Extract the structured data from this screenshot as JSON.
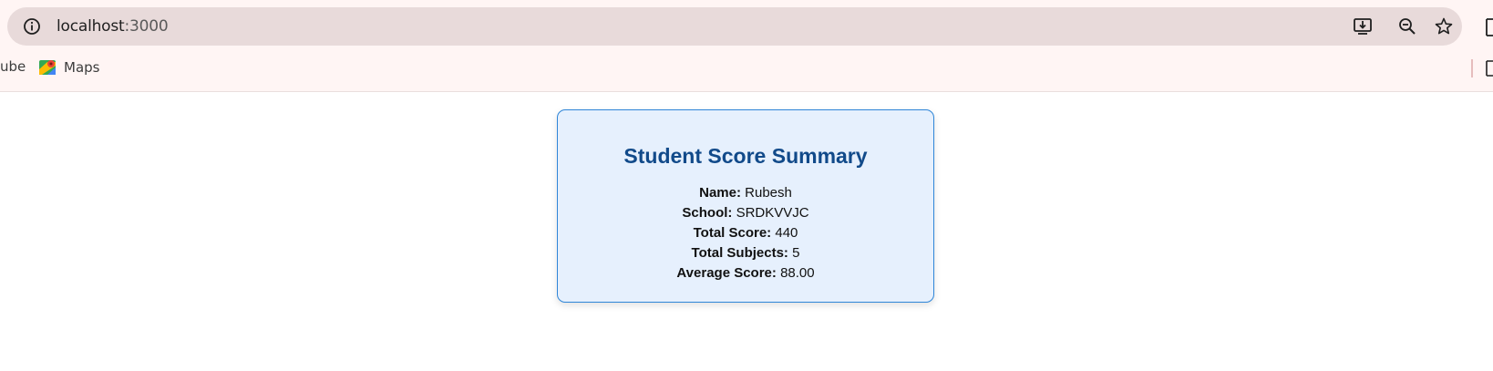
{
  "browser": {
    "url_host": "localhost",
    "url_port": ":3000",
    "icons": {
      "info": "info-icon",
      "install": "install-app-icon",
      "zoom": "zoom-out-icon",
      "bookmark": "star-icon"
    },
    "bookmarks": {
      "partial_label": "ube",
      "maps_label": "Maps"
    }
  },
  "summary": {
    "title": "Student Score Summary",
    "fields": [
      {
        "label": "Name:",
        "value": "Rubesh"
      },
      {
        "label": "School:",
        "value": "SRDKVVJC"
      },
      {
        "label": "Total Score:",
        "value": "440"
      },
      {
        "label": "Total Subjects:",
        "value": "5"
      },
      {
        "label": "Average Score:",
        "value": "88.00"
      }
    ]
  },
  "colors": {
    "card_background": "#e6f0fd",
    "card_border": "#2f86d8",
    "title": "#114a8a",
    "chrome_background": "#fff5f4",
    "omnibox_background": "#e8dada"
  }
}
